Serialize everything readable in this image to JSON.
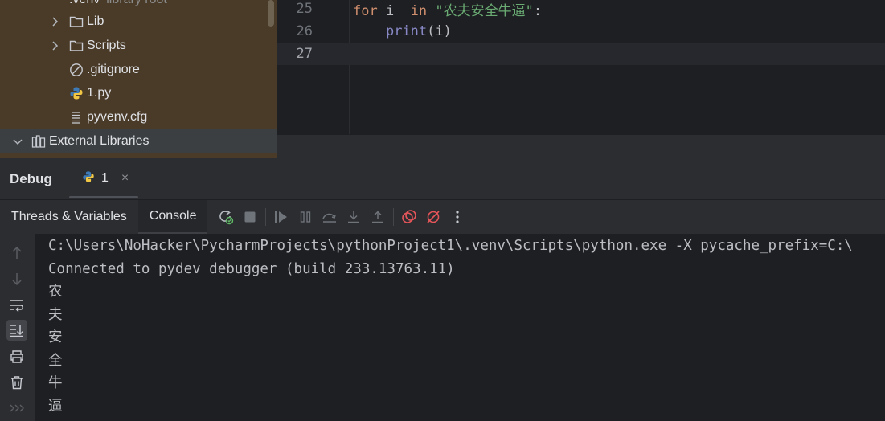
{
  "project_tree": {
    "venv_row": {
      "name": ".venv",
      "note": "library root"
    },
    "items": [
      {
        "label": "Lib",
        "kind": "folder"
      },
      {
        "label": "Scripts",
        "kind": "folder"
      },
      {
        "label": ".gitignore",
        "kind": "ignore"
      },
      {
        "label": "1.py",
        "kind": "python"
      },
      {
        "label": "pyvenv.cfg",
        "kind": "config"
      }
    ],
    "external_libraries": "External Libraries"
  },
  "editor": {
    "lines": [
      {
        "number": "25",
        "kw1": "for",
        "var": " i  ",
        "kw2": "in",
        "sp": " ",
        "str": "\"农夫安全牛逼\"",
        "tail": ":"
      },
      {
        "number": "26",
        "indent": "    ",
        "fn": "print",
        "args": "(i)"
      },
      {
        "number": "27"
      }
    ]
  },
  "debug": {
    "title": "Debug",
    "run_tab": "1",
    "close": "×",
    "tabs": [
      "Threads & Variables",
      "Console"
    ],
    "active_tab": "Console"
  },
  "console": {
    "lines": [
      "C:\\Users\\NoHacker\\PycharmProjects\\pythonProject1\\.venv\\Scripts\\python.exe -X pycache_prefix=C:\\",
      "Connected to pydev debugger (build 233.13763.11)",
      "农",
      "夫",
      "安",
      "全",
      "牛",
      "逼"
    ]
  },
  "colors": {
    "tree_bg": "#4a3b28",
    "editor_bg": "#1e1f22",
    "keyword": "#cf8e6d",
    "string": "#6aab73",
    "builtin": "#8888c6"
  }
}
